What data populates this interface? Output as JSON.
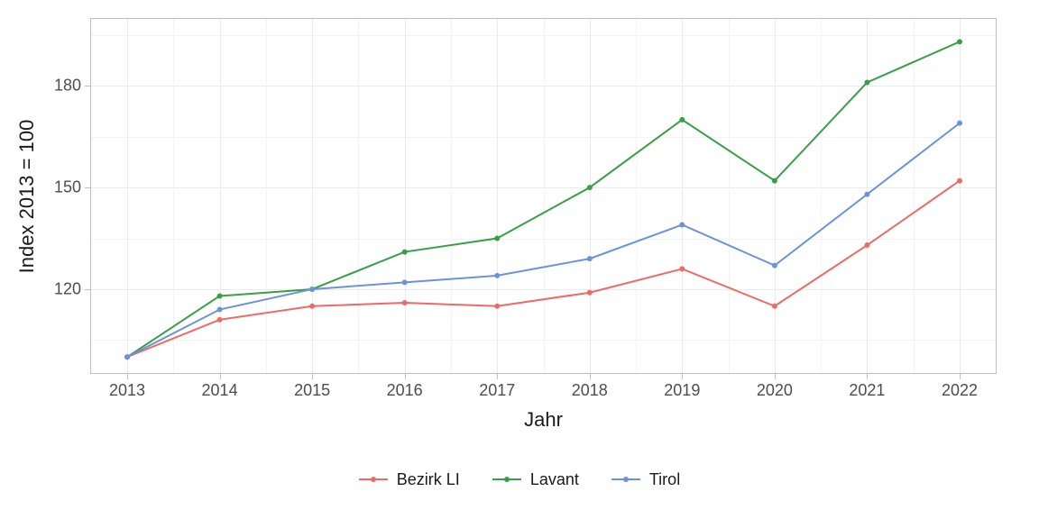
{
  "chart_data": {
    "type": "line",
    "title": "",
    "xlabel": "Jahr",
    "ylabel": "Index  2013  =  100",
    "x": [
      2013,
      2014,
      2015,
      2016,
      2017,
      2018,
      2019,
      2020,
      2021,
      2022
    ],
    "x_ticks": [
      2013,
      2014,
      2015,
      2016,
      2017,
      2018,
      2019,
      2020,
      2021,
      2022
    ],
    "y_ticks": [
      120,
      150,
      180
    ],
    "ylim": [
      95,
      200
    ],
    "xlim": [
      2012.6,
      2022.4
    ],
    "series": [
      {
        "name": "Bezirk LI",
        "color": "#ee6a66",
        "values": [
          100,
          111,
          115,
          116,
          115,
          119,
          126,
          115,
          133,
          152
        ]
      },
      {
        "name": "Lavant",
        "color": "#37a047",
        "values": [
          100,
          118,
          120,
          131,
          135,
          150,
          170,
          152,
          181,
          193
        ]
      },
      {
        "name": "Tirol",
        "color": "#6b92dc",
        "values": [
          100,
          114,
          120,
          122,
          124,
          129,
          139,
          127,
          148,
          169
        ]
      }
    ],
    "legend_position": "bottom",
    "grid": true
  }
}
